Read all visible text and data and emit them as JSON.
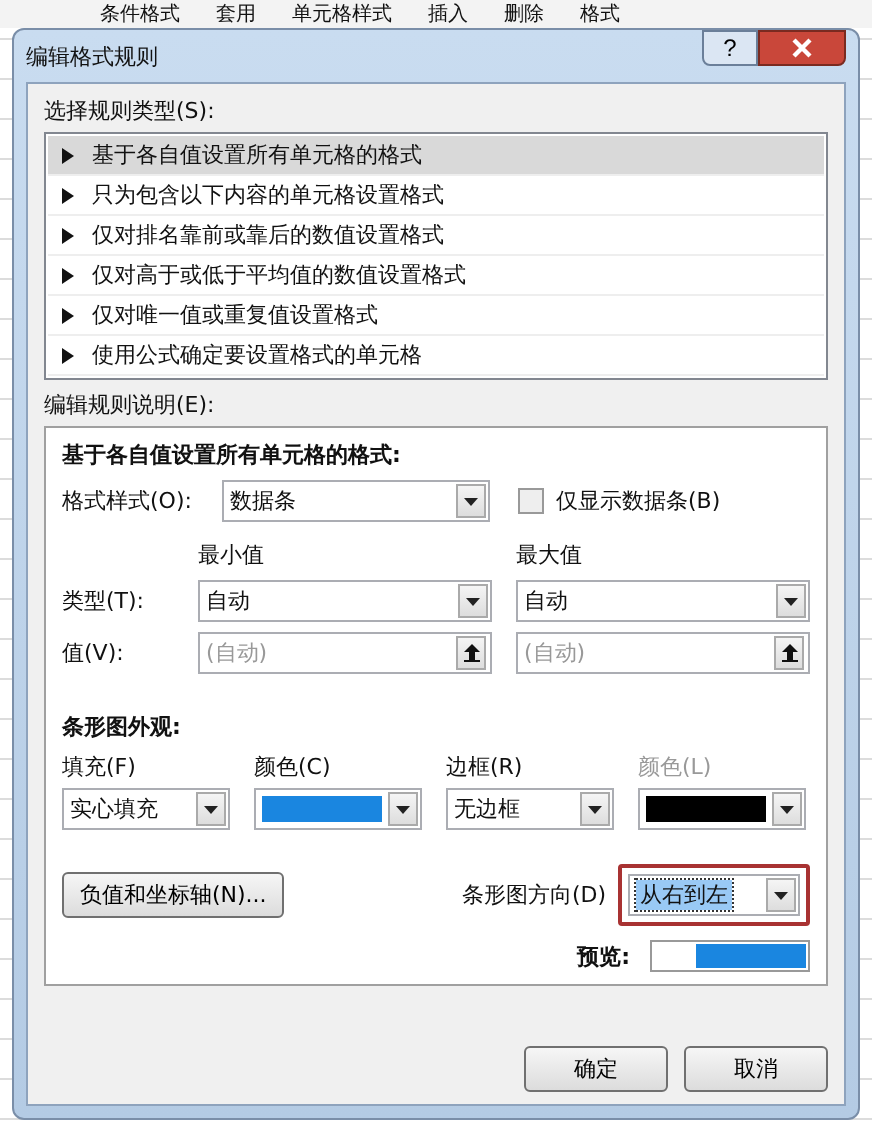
{
  "ribbon": [
    "条件格式",
    "套用",
    "单元格样式",
    "插入",
    "删除",
    "格式"
  ],
  "window": {
    "title": "编辑格式规则",
    "help": "?"
  },
  "rule_types": {
    "label": "选择规则类型(S):",
    "items": [
      {
        "label": "基于各自值设置所有单元格的格式",
        "selected": true
      },
      {
        "label": "只为包含以下内容的单元格设置格式",
        "selected": false
      },
      {
        "label": "仅对排名靠前或靠后的数值设置格式",
        "selected": false
      },
      {
        "label": "仅对高于或低于平均值的数值设置格式",
        "selected": false
      },
      {
        "label": "仅对唯一值或重复值设置格式",
        "selected": false
      },
      {
        "label": "使用公式确定要设置格式的单元格",
        "selected": false
      }
    ]
  },
  "description": {
    "label": "编辑规则说明(E):",
    "heading": "基于各自值设置所有单元格的格式:",
    "format_style": {
      "label": "格式样式(O):",
      "value": "数据条"
    },
    "bar_only": {
      "label": "仅显示数据条(B)",
      "checked": false
    },
    "type_label": "类型(T):",
    "value_label": "值(V):",
    "bounds": [
      {
        "heading": "最小值",
        "type": "自动",
        "placeholder": "(自动)"
      },
      {
        "heading": "最大值",
        "type": "自动",
        "placeholder": "(自动)"
      }
    ],
    "appearance": {
      "heading": "条形图外观:",
      "fill": {
        "label": "填充(F)",
        "value": "实心填充"
      },
      "fill_color": {
        "label": "颜色(C)",
        "color": "#1a86e0",
        "disabled": false
      },
      "border": {
        "label": "边框(R)",
        "value": "无边框"
      },
      "border_color": {
        "label": "颜色(L)",
        "color": "#000000",
        "disabled": true
      }
    },
    "axis_button": "负值和坐标轴(N)...",
    "direction": {
      "label": "条形图方向(D)",
      "value": "从右到左",
      "highlighted": true
    },
    "preview": {
      "label": "预览:",
      "level": 0.72,
      "color": "#1a86e0"
    }
  },
  "buttons": [
    "确定",
    "取消"
  ]
}
